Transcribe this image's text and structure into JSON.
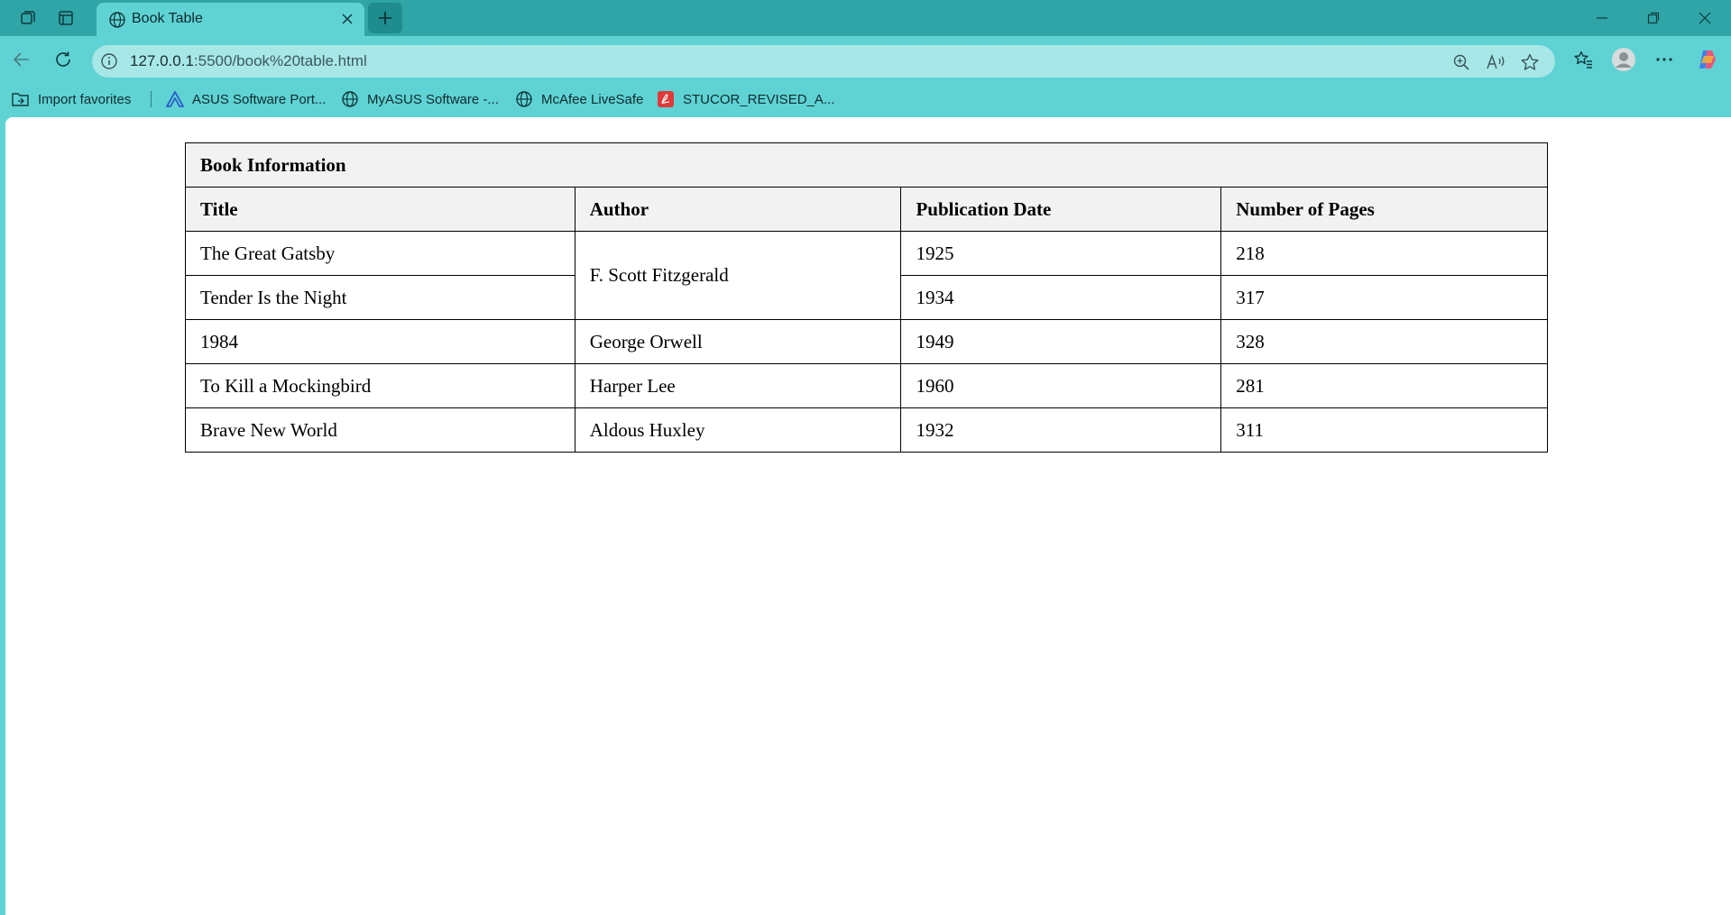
{
  "browser": {
    "tab": {
      "title": "Book Table"
    },
    "address": {
      "host": "127.0.0.1",
      "rest": ":5500/book%20table.html"
    },
    "bookmarks": [
      {
        "label": "Import favorites",
        "icon": "folder-import-icon"
      },
      {
        "label": "ASUS Software Port...",
        "icon": "asus-logo-icon"
      },
      {
        "label": "MyASUS Software -...",
        "icon": "globe-icon"
      },
      {
        "label": "McAfee LiveSafe",
        "icon": "globe-icon"
      },
      {
        "label": "STUCOR_REVISED_A...",
        "icon": "pdf-icon"
      }
    ],
    "colors": {
      "tabstrip": "#2fa5a8",
      "toolbar": "#5fd2d4",
      "omnibox": "#a7e7e8",
      "header_cell": "#f2f2f2"
    }
  },
  "table": {
    "caption": "Book Information",
    "headers": [
      "Title",
      "Author",
      "Publication Date",
      "Number of Pages"
    ],
    "rows": [
      {
        "title": "The Great Gatsby",
        "author": "F. Scott Fitzgerald",
        "date": "1925",
        "pages": "218"
      },
      {
        "title": "Tender Is the Night",
        "author": "F. Scott Fitzgerald",
        "date": "1934",
        "pages": "317"
      },
      {
        "title": "1984",
        "author": "George Orwell",
        "date": "1949",
        "pages": "328"
      },
      {
        "title": "To Kill a Mockingbird",
        "author": "Harper Lee",
        "date": "1960",
        "pages": "281"
      },
      {
        "title": "Brave New World",
        "author": "Aldous Huxley",
        "date": "1932",
        "pages": "311"
      }
    ]
  }
}
